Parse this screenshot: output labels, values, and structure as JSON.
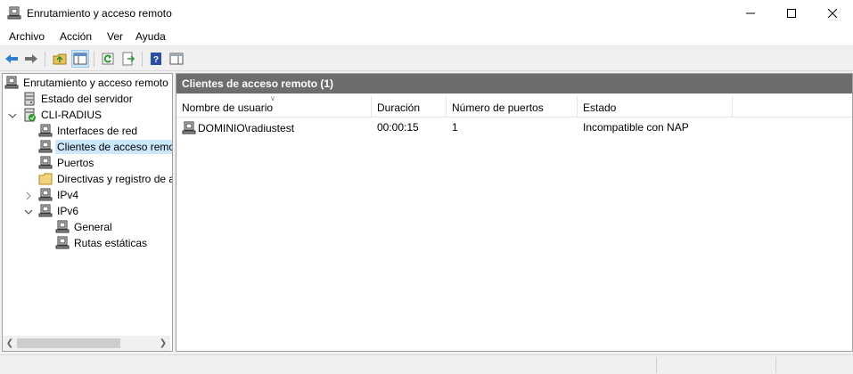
{
  "window": {
    "title": "Enrutamiento y acceso remoto",
    "app_icon": "server-icon"
  },
  "menu": [
    "Archivo",
    "Acción",
    "Ver",
    "Ayuda"
  ],
  "toolbar": {
    "buttons": [
      "back-arrow-icon",
      "forward-arrow-icon",
      "up-folder-icon",
      "show-hide-tree-icon",
      "refresh-icon",
      "export-list-icon",
      "help-icon",
      "properties-pane-icon"
    ]
  },
  "tree": {
    "root": "Enrutamiento y acceso remoto",
    "server_status": "Estado del servidor",
    "server": "CLI-RADIUS",
    "network_interfaces": "Interfaces de red",
    "remote_clients": "Clientes de acceso remo",
    "ports": "Puertos",
    "policies": "Directivas y registro de a",
    "ipv4": "IPv4",
    "ipv6": "IPv6",
    "general": "General",
    "static_routes": "Rutas estáticas"
  },
  "content": {
    "header": "Clientes de acceso remoto (1)",
    "columns": [
      "Nombre de usuario",
      "Duración",
      "Número de puertos",
      "Estado"
    ],
    "rows": [
      {
        "user": "DOMINIO\\radiustest",
        "duration": "00:00:15",
        "ports": "1",
        "status": "Incompatible con NAP"
      }
    ]
  },
  "colors": {
    "header_bg": "#6d6d6d",
    "selection": "#cce8ff",
    "accent_blue": "#1e73be"
  }
}
